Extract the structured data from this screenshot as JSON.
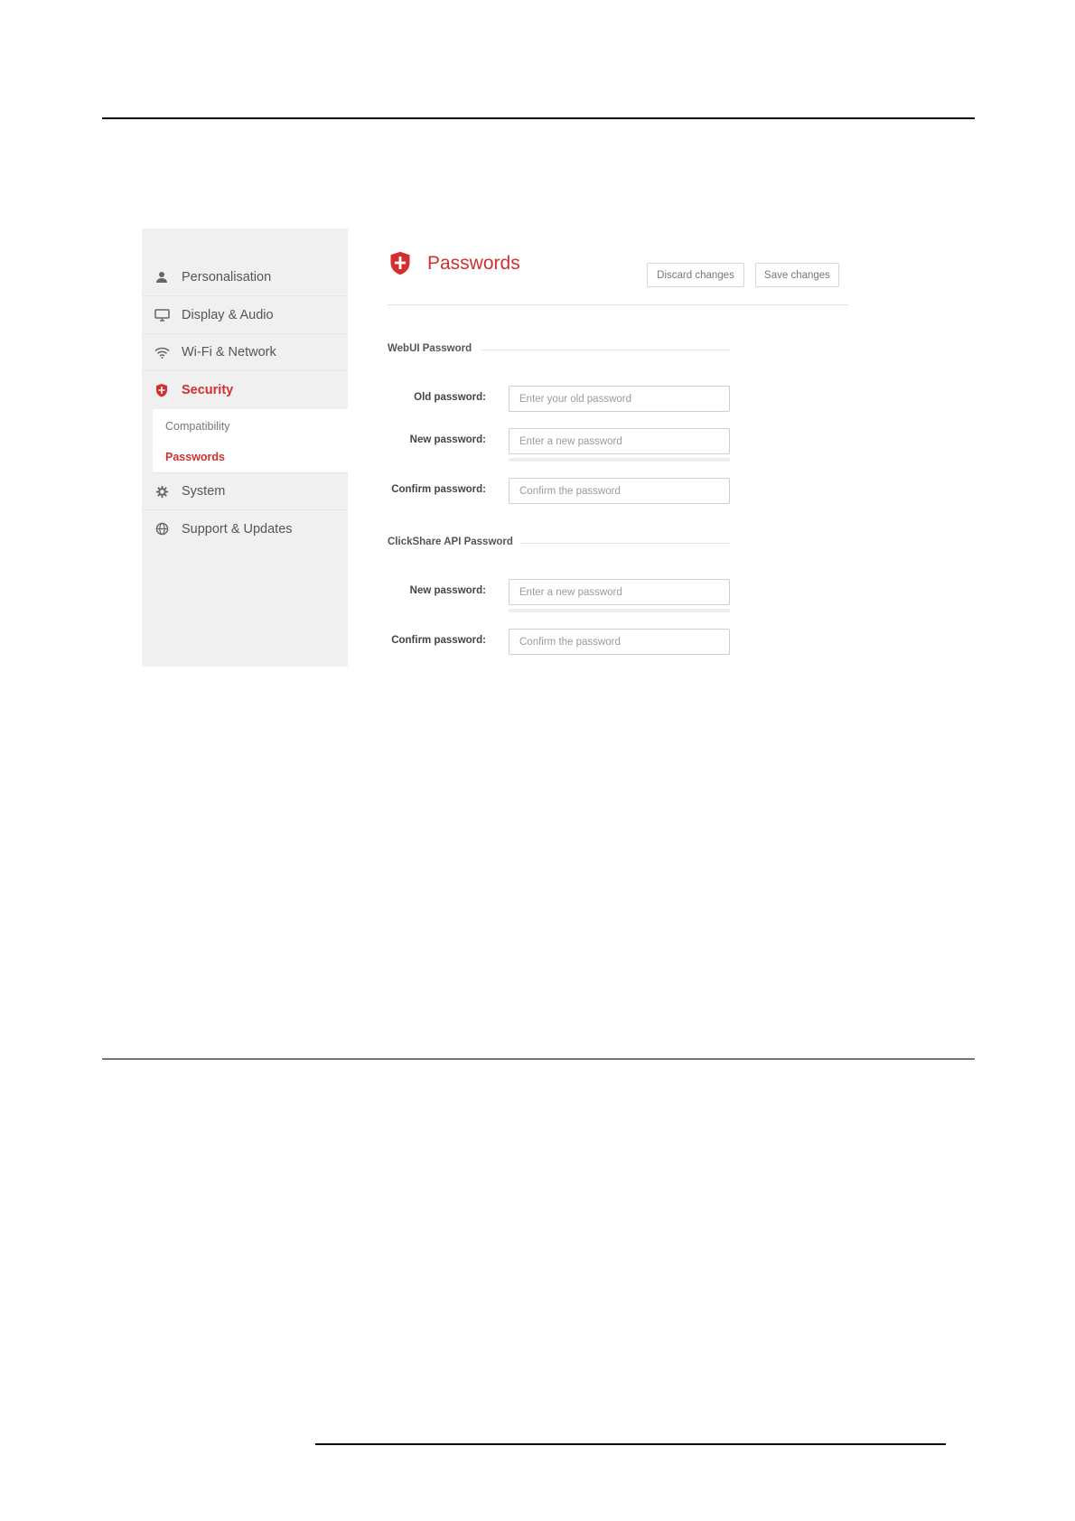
{
  "sidebar": {
    "items": [
      {
        "label": "Personalisation",
        "icon": "user-icon"
      },
      {
        "label": "Display & Audio",
        "icon": "monitor-icon"
      },
      {
        "label": "Wi-Fi & Network",
        "icon": "wifi-icon"
      },
      {
        "label": "Security",
        "icon": "shield-icon",
        "active": true
      },
      {
        "label": "System",
        "icon": "gear-icon"
      },
      {
        "label": "Support & Updates",
        "icon": "globe-icon"
      }
    ],
    "security_subitems": [
      {
        "label": "Compatibility"
      },
      {
        "label": "Passwords",
        "active": true
      }
    ]
  },
  "page": {
    "title": "Passwords",
    "discard_label": "Discard changes",
    "save_label": "Save changes"
  },
  "webui_section": {
    "title": "WebUI Password",
    "old_label": "Old password:",
    "old_placeholder": "Enter your old password",
    "new_label": "New password:",
    "new_placeholder": "Enter a new password",
    "confirm_label": "Confirm password:",
    "confirm_placeholder": "Confirm the password"
  },
  "api_section": {
    "title": "ClickShare API Password",
    "new_label": "New password:",
    "new_placeholder": "Enter a new password",
    "confirm_label": "Confirm password:",
    "confirm_placeholder": "Confirm the password"
  },
  "colors": {
    "accent": "#d32f2f",
    "sidebar_bg": "#f0f0f0"
  }
}
